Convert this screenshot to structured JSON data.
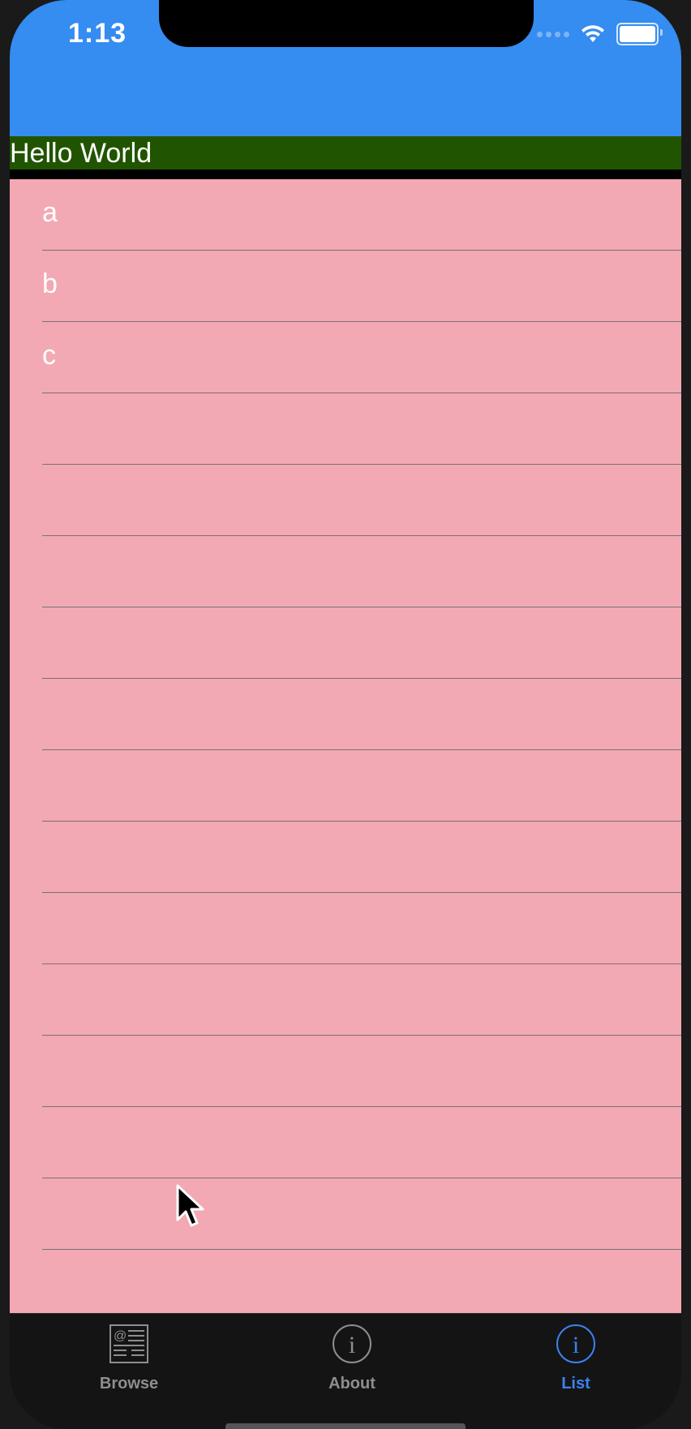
{
  "status_bar": {
    "time": "1:13"
  },
  "header": {
    "title": "Hello World"
  },
  "list": {
    "items": [
      "a",
      "b",
      "c",
      "",
      "",
      "",
      "",
      "",
      "",
      "",
      "",
      "",
      "",
      "",
      "",
      ""
    ]
  },
  "tab_bar": {
    "tabs": [
      {
        "label": "Browse",
        "icon": "newspaper-icon",
        "selected": false
      },
      {
        "label": "About",
        "icon": "info-icon",
        "selected": false
      },
      {
        "label": "List",
        "icon": "info-icon",
        "selected": true
      }
    ]
  },
  "colors": {
    "header_blue": "#358cf1",
    "hello_bar_green": "#215400",
    "list_background": "#f2a9b4",
    "tab_selected": "#3b82f0",
    "tab_unselected": "#8e8e8e"
  }
}
